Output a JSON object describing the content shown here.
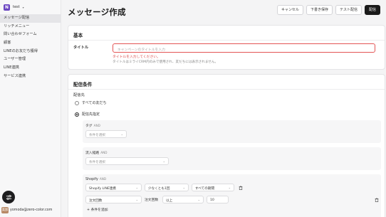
{
  "sidebar": {
    "workspace": {
      "logo": "N",
      "name": "test"
    },
    "items": [
      {
        "label": "メッセージ配信",
        "active": true
      },
      {
        "label": "リッチメニュー"
      },
      {
        "label": "問い合わせフォーム"
      },
      {
        "label": "顧客"
      },
      {
        "label": "LINEのお友だち獲得"
      },
      {
        "label": "ユーザー管理"
      },
      {
        "label": "LINE連携"
      },
      {
        "label": "サービス連携"
      }
    ],
    "user": {
      "avatar": "美加",
      "email": "yomoda@zero-color.com"
    }
  },
  "header": {
    "title": "メッセージ作成",
    "buttons": {
      "cancel": "キャンセル",
      "draft": "下書き保存",
      "test": "テスト配信",
      "publish": "配信"
    }
  },
  "basic": {
    "section_title": "基本",
    "title_label": "タイトル",
    "title_placeholder": "キャンペーンのタイトルを入力",
    "title_error": "タイトルを入力してください。",
    "title_hint": "タイトルはミライCRM内のみで使用され、友だちには表示されません。"
  },
  "delivery": {
    "section_title": "配信条件",
    "target_label": "配信先",
    "options": [
      {
        "label": "すべての友だち",
        "selected": false
      },
      {
        "label": "配信先指定",
        "selected": true
      }
    ],
    "tag": {
      "label": "タグ",
      "and": "AND",
      "placeholder": "条件を選択"
    },
    "inflow": {
      "label": "流入経路",
      "and": "AND",
      "placeholder": "条件を選択"
    },
    "shopify": {
      "label": "Shopify",
      "and": "AND",
      "row1": {
        "field": "Shopify LINE連携",
        "qualifier": "少なくとも1回",
        "period": "すべての期間"
      },
      "row2": {
        "field": "注文回数",
        "field_label": "注文回数",
        "operator": "以上",
        "value": "10"
      },
      "add_condition": "条件を追加"
    }
  }
}
